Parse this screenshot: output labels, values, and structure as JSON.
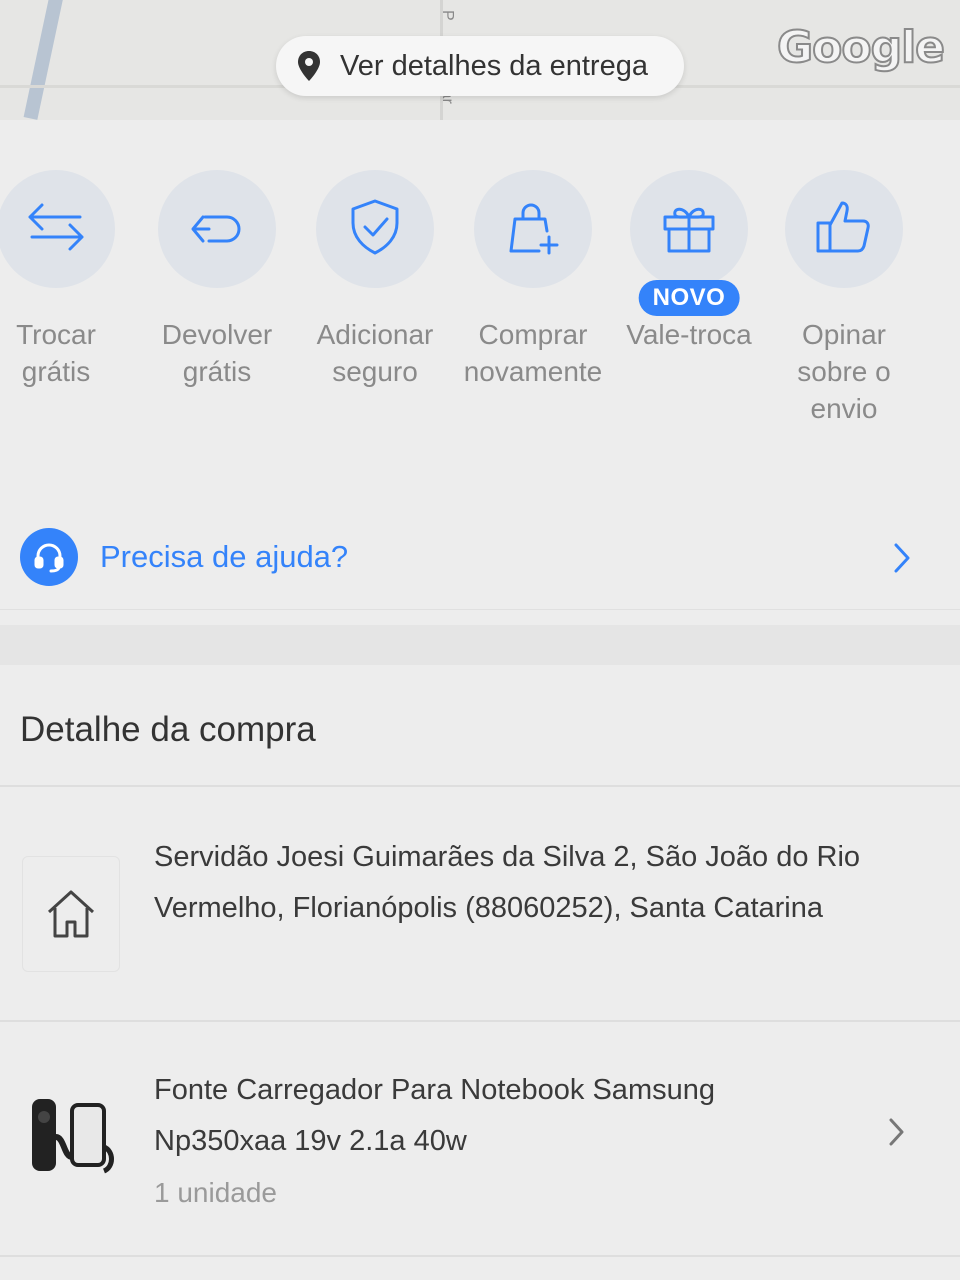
{
  "map": {
    "delivery_button": "Ver detalhes da entrega",
    "map_logo": "Google",
    "street_fragment_top": "P",
    "street_fragment_bottom": "iar"
  },
  "actions": [
    {
      "label": "Trocar grátis",
      "icon": "swap-arrows-icon"
    },
    {
      "label": "Devolver grátis",
      "icon": "return-arrow-icon"
    },
    {
      "label": "Adicionar seguro",
      "icon": "shield-check-icon"
    },
    {
      "label": "Comprar novamente",
      "icon": "shopping-bag-plus-icon"
    },
    {
      "label": "Vale-troca",
      "icon": "gift-icon",
      "badge": "NOVO"
    },
    {
      "label": "Opinar sobre o envio",
      "icon": "thumbs-up-icon"
    }
  ],
  "help": {
    "label": "Precisa de ajuda?",
    "icon": "headset-icon"
  },
  "purchase_detail": {
    "title": "Detalhe da compra",
    "address": "Servidão Joesi Guimarães da Silva 2, São João do Rio Vermelho, Florianópolis (88060252), Santa Catarina",
    "product": {
      "title": "Fonte Carregador Para Notebook Samsung Np350xaa 19v 2.1a 40w",
      "quantity": "1 unidade"
    }
  },
  "colors": {
    "accent": "#3483fa",
    "icon_circle": "#dfe3e9",
    "muted_text": "#8a8a8a"
  }
}
